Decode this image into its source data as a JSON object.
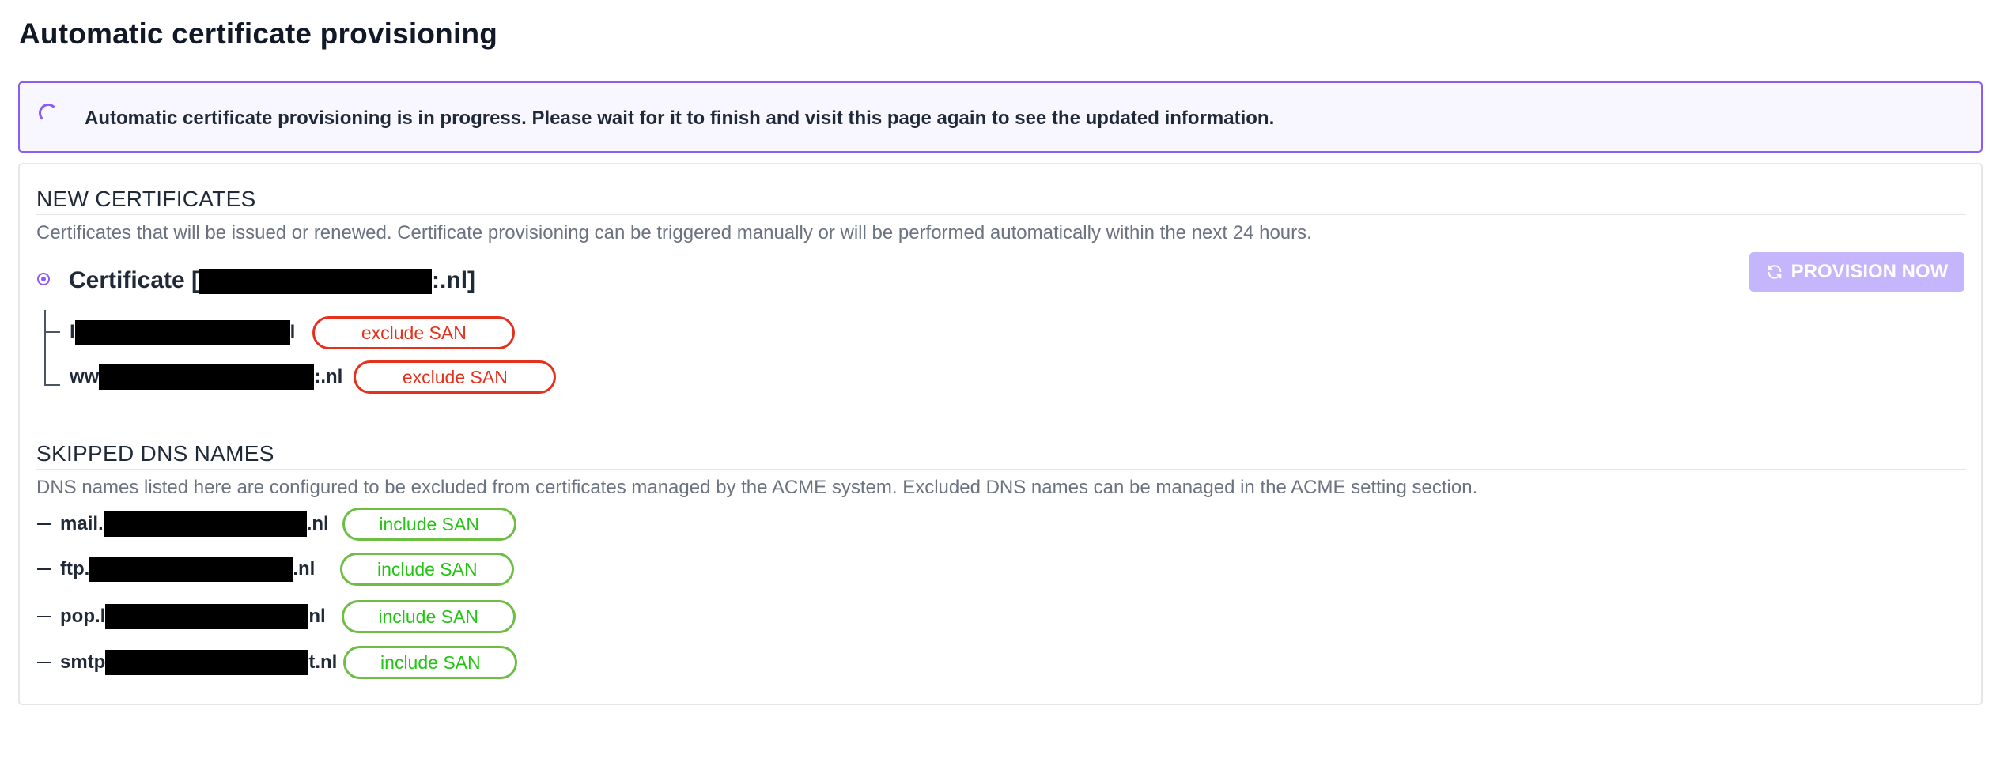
{
  "page": {
    "title": "Automatic certificate provisioning"
  },
  "banner": {
    "icon": "spinner-icon",
    "message": "Automatic certificate provisioning is in progress. Please wait for it to finish and visit this page again to see the updated information."
  },
  "new_certificates": {
    "heading": "NEW CERTIFICATES",
    "description": "Certificates that will be issued or renewed. Certificate provisioning can be triggered manually or will be performed automatically within the next 24 hours.",
    "certificate": {
      "label_prefix": "Certificate [",
      "label_suffix": ":.nl]"
    },
    "provision_button": {
      "label": "PROVISION NOW",
      "icon": "refresh-icon"
    },
    "sans": [
      {
        "prefix": "l",
        "suffix": "l",
        "action": "exclude SAN"
      },
      {
        "prefix": "ww",
        "suffix": ":.nl",
        "action": "exclude SAN"
      }
    ]
  },
  "skipped_dns": {
    "heading": "SKIPPED DNS NAMES",
    "description": "DNS names listed here are configured to be excluded from certificates managed by the ACME system. Excluded DNS names can be managed in the ACME setting section.",
    "names": [
      {
        "prefix": "mail.",
        "suffix": ".nl",
        "action": "include SAN"
      },
      {
        "prefix": "ftp.",
        "suffix": ".nl",
        "action": "include SAN"
      },
      {
        "prefix": "pop.l",
        "suffix": "nl",
        "action": "include SAN"
      },
      {
        "prefix": "smtp",
        "suffix": "t.nl",
        "action": "include SAN"
      }
    ]
  },
  "colors": {
    "accent": "#8b5cf6",
    "exclude": "#e5311b",
    "include": "#21c512",
    "button_disabled": "#c4b5fd"
  }
}
